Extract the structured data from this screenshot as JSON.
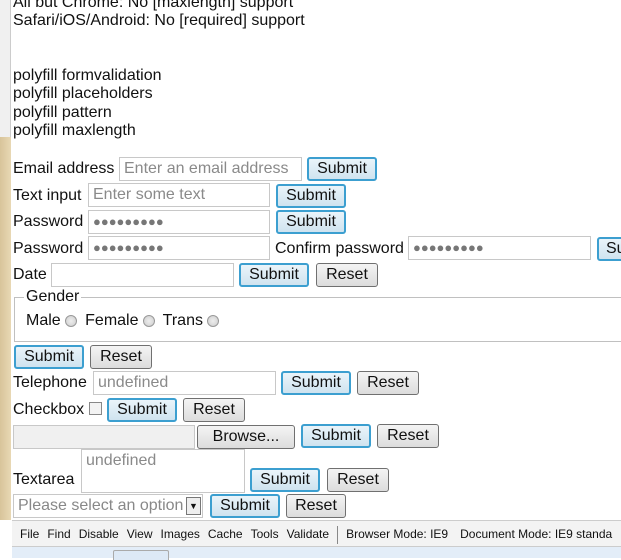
{
  "notes": [
    "All but Chrome: No [maxlength] support",
    "Safari/iOS/Android: No [required] support"
  ],
  "polyfills": [
    "polyfill formvalidation",
    "polyfill placeholders",
    "polyfill pattern",
    "polyfill maxlength"
  ],
  "form": {
    "email": {
      "label": "Email address",
      "placeholder": "Enter an email address"
    },
    "text": {
      "label": "Text input",
      "placeholder": "Enter some text"
    },
    "password1": {
      "label": "Password",
      "value": "●●●●●●●●●"
    },
    "password2": {
      "label": "Password",
      "value": "●●●●●●●●●",
      "confirm_label": "Confirm password",
      "confirm_value": "●●●●●●●●●",
      "cut_button": "Su"
    },
    "date": {
      "label": "Date",
      "value": ""
    },
    "gender": {
      "legend": "Gender",
      "options": [
        "Male",
        "Female",
        "Trans"
      ]
    },
    "telephone": {
      "label": "Telephone",
      "placeholder": "undefined"
    },
    "checkbox": {
      "label": "Checkbox",
      "checked": false
    },
    "file": {
      "browse": "Browse..."
    },
    "textarea": {
      "label": "Textarea",
      "placeholder": "undefined"
    },
    "select": {
      "selected": "Please select an option"
    },
    "submit": "Submit",
    "reset": "Reset"
  },
  "devtools": {
    "menu": [
      "File",
      "Find",
      "Disable",
      "View",
      "Images",
      "Cache",
      "Tools",
      "Validate"
    ],
    "browser_mode": "Browser Mode: IE9",
    "document_mode": "Document Mode: IE9 standa"
  }
}
